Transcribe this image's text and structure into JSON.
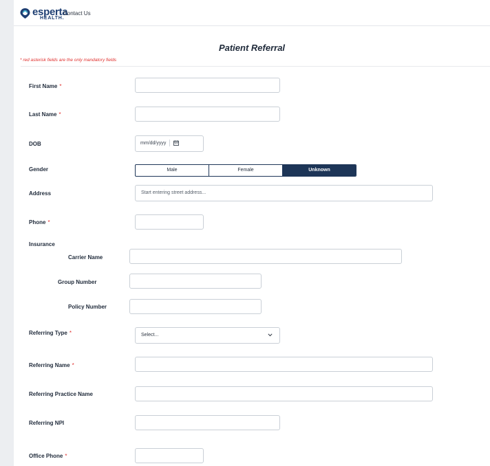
{
  "header": {
    "logo_text": "esperta",
    "logo_sub": "HEALTH.",
    "contact_label": "Contact Us"
  },
  "page": {
    "title": "Patient Referral",
    "mandatory_note": "* red asterisk fields are the only mandatory fields"
  },
  "form": {
    "first_name": {
      "label": "First Name",
      "required": "*",
      "value": ""
    },
    "last_name": {
      "label": "Last Name",
      "required": "*",
      "value": ""
    },
    "dob": {
      "label": "DOB",
      "placeholder": "mm/dd/yyyy"
    },
    "gender": {
      "label": "Gender",
      "options": [
        "Male",
        "Female",
        "Unknown"
      ],
      "selected": "Unknown"
    },
    "address": {
      "label": "Address",
      "placeholder": "Start entering street address..."
    },
    "phone": {
      "label": "Phone",
      "required": "*",
      "value": ""
    },
    "insurance": {
      "label": "Insurance",
      "carrier_name": {
        "label": "Carrier Name",
        "value": ""
      },
      "group_number": {
        "label": "Group Number",
        "value": ""
      },
      "policy_number": {
        "label": "Policy Number",
        "value": ""
      }
    },
    "referring_type": {
      "label": "Referring Type",
      "required": "*",
      "selected": "Select..."
    },
    "referring_name": {
      "label": "Referring Name",
      "required": "*",
      "value": ""
    },
    "referring_practice_name": {
      "label": "Referring Practice Name",
      "value": ""
    },
    "referring_npi": {
      "label": "Referring NPI",
      "value": ""
    },
    "office_phone": {
      "label": "Office Phone",
      "required": "*",
      "value": ""
    }
  },
  "colors": {
    "brand_navy": "#1d3557",
    "required_red": "#e0312f"
  }
}
